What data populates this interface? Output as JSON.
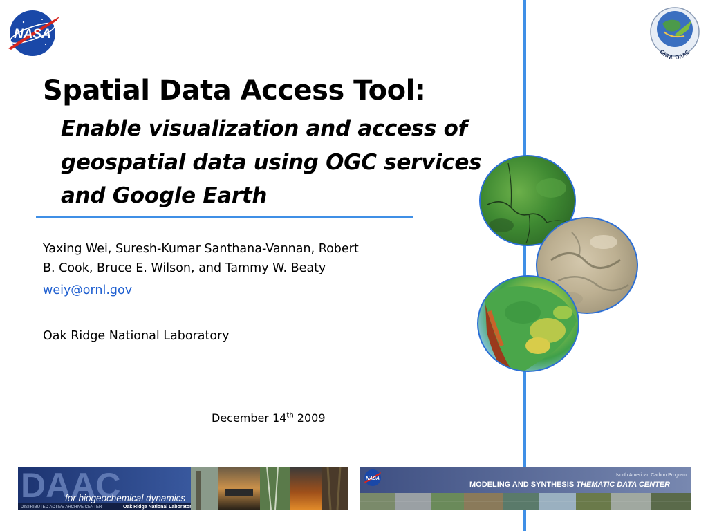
{
  "logos": {
    "nasa_text": "NASA",
    "daac_text": "ORNL DAAC"
  },
  "slide": {
    "title": "Spatial Data Access Tool:",
    "subtitle_lines": [
      "Enable visualization and access of",
      "geospatial data using OGC services",
      "and Google Earth"
    ],
    "authors_lines": [
      "Yaxing Wei, Suresh-Kumar Santhana-Vannan, Robert",
      "B. Cook, Bruce E. Wilson, and Tammy W. Beaty"
    ],
    "email": "weiy@ornl.gov",
    "organization": "Oak Ridge National Laboratory",
    "date_prefix": "December 14",
    "date_sup": "th",
    "date_suffix": " 2009"
  },
  "banners": {
    "left": {
      "big": "DAAC",
      "caption": "for biogeochemical dynamics",
      "footer_left": "DISTRIBUTED ACTIVE ARCHIVE CENTER",
      "footer_right": "Oak Ridge National Laboratory"
    },
    "right": {
      "program": "North American Carbon Program",
      "center_a": "MODELING AND SYNTHESIS ",
      "center_b": "THEMATIC DATA CENTER",
      "nasa": "NASA"
    }
  },
  "colors": {
    "accent_line": "#3f8fe6",
    "link": "#1f5fd0"
  }
}
